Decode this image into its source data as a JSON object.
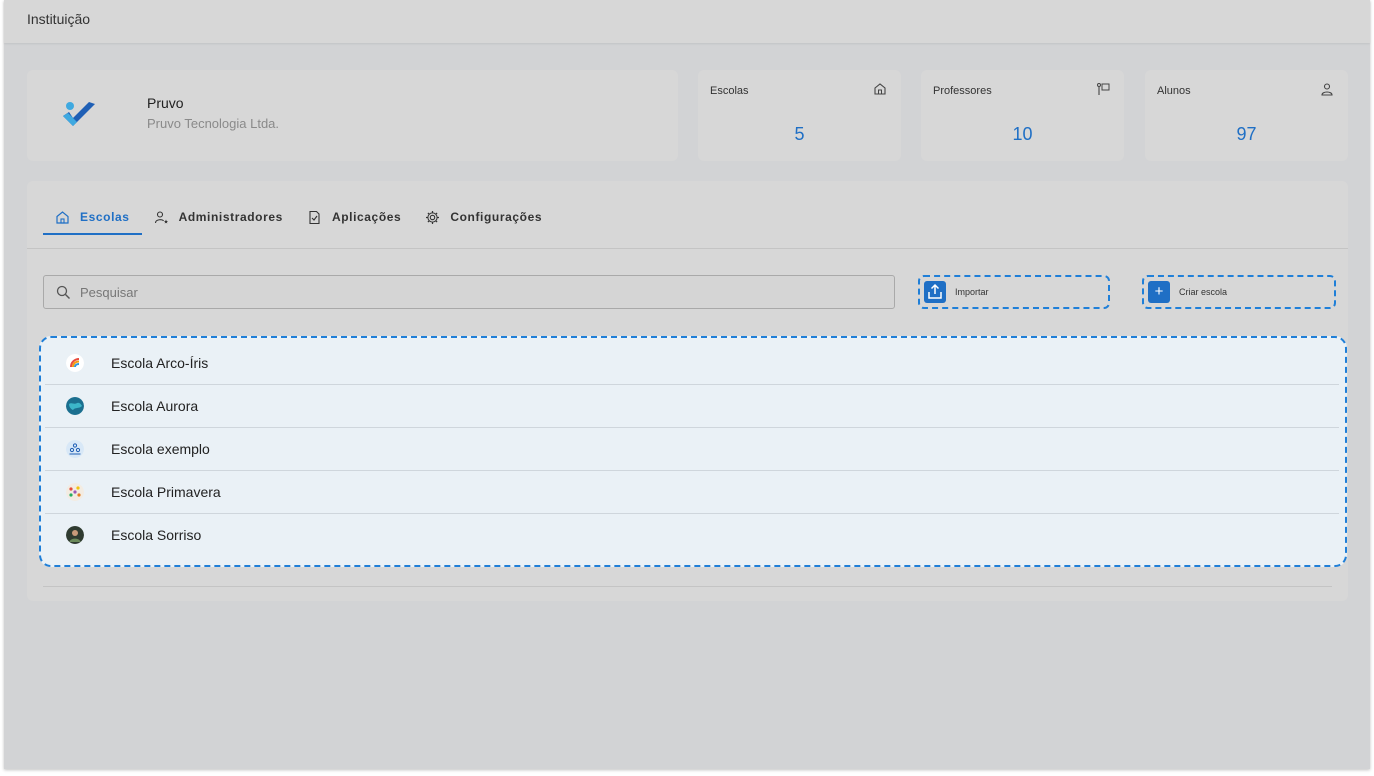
{
  "header": {
    "title": "Instituição"
  },
  "institution": {
    "name": "Pruvo",
    "subtitle": "Pruvo Tecnologia Ltda."
  },
  "stats": [
    {
      "label": "Escolas",
      "value": "5",
      "icon": "home-icon"
    },
    {
      "label": "Professores",
      "value": "10",
      "icon": "teacher-board-icon"
    },
    {
      "label": "Alunos",
      "value": "97",
      "icon": "user-icon"
    }
  ],
  "tabs": [
    {
      "label": "Escolas",
      "icon": "home-icon",
      "active": true
    },
    {
      "label": "Administradores",
      "icon": "user-star-icon",
      "active": false
    },
    {
      "label": "Aplicações",
      "icon": "document-check-icon",
      "active": false
    },
    {
      "label": "Configurações",
      "icon": "gear-icon",
      "active": false
    }
  ],
  "search": {
    "placeholder": "Pesquisar"
  },
  "actions": {
    "import_label": "Importar",
    "create_label": "Criar escola"
  },
  "schools": [
    {
      "name": "Escola Arco-Íris",
      "avatar": "rainbow-avatar"
    },
    {
      "name": "Escola Aurora",
      "avatar": "earth-avatar"
    },
    {
      "name": "Escola exemplo",
      "avatar": "people-avatar"
    },
    {
      "name": "Escola Primavera",
      "avatar": "flowers-avatar"
    },
    {
      "name": "Escola Sorriso",
      "avatar": "person-avatar"
    }
  ],
  "colors": {
    "accent": "#1f6fc5",
    "focus_outline": "#1f7fd8"
  }
}
